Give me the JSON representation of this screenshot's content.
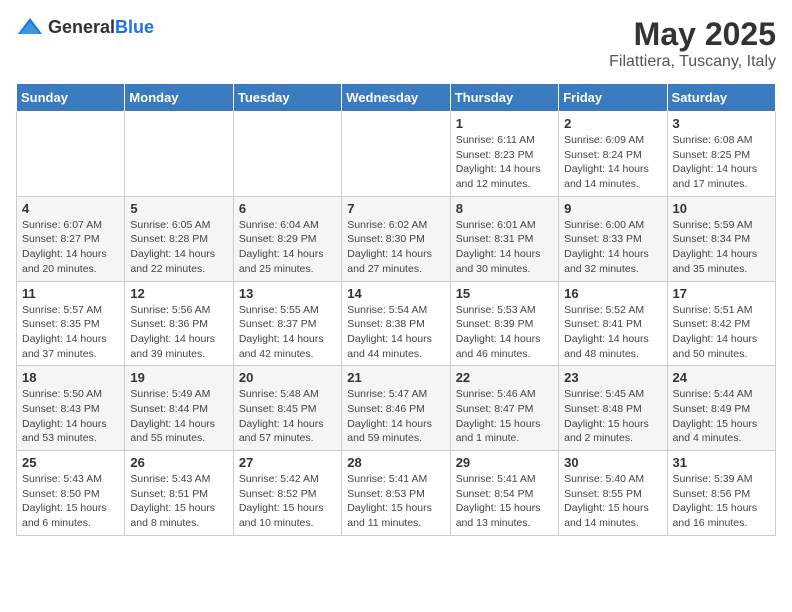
{
  "logo": {
    "general": "General",
    "blue": "Blue"
  },
  "title": "May 2025",
  "subtitle": "Filattiera, Tuscany, Italy",
  "days": [
    "Sunday",
    "Monday",
    "Tuesday",
    "Wednesday",
    "Thursday",
    "Friday",
    "Saturday"
  ],
  "weeks": [
    [
      {
        "day": "",
        "info": ""
      },
      {
        "day": "",
        "info": ""
      },
      {
        "day": "",
        "info": ""
      },
      {
        "day": "",
        "info": ""
      },
      {
        "day": "1",
        "info": "Sunrise: 6:11 AM\nSunset: 8:23 PM\nDaylight: 14 hours and 12 minutes."
      },
      {
        "day": "2",
        "info": "Sunrise: 6:09 AM\nSunset: 8:24 PM\nDaylight: 14 hours and 14 minutes."
      },
      {
        "day": "3",
        "info": "Sunrise: 6:08 AM\nSunset: 8:25 PM\nDaylight: 14 hours and 17 minutes."
      }
    ],
    [
      {
        "day": "4",
        "info": "Sunrise: 6:07 AM\nSunset: 8:27 PM\nDaylight: 14 hours and 20 minutes."
      },
      {
        "day": "5",
        "info": "Sunrise: 6:05 AM\nSunset: 8:28 PM\nDaylight: 14 hours and 22 minutes."
      },
      {
        "day": "6",
        "info": "Sunrise: 6:04 AM\nSunset: 8:29 PM\nDaylight: 14 hours and 25 minutes."
      },
      {
        "day": "7",
        "info": "Sunrise: 6:02 AM\nSunset: 8:30 PM\nDaylight: 14 hours and 27 minutes."
      },
      {
        "day": "8",
        "info": "Sunrise: 6:01 AM\nSunset: 8:31 PM\nDaylight: 14 hours and 30 minutes."
      },
      {
        "day": "9",
        "info": "Sunrise: 6:00 AM\nSunset: 8:33 PM\nDaylight: 14 hours and 32 minutes."
      },
      {
        "day": "10",
        "info": "Sunrise: 5:59 AM\nSunset: 8:34 PM\nDaylight: 14 hours and 35 minutes."
      }
    ],
    [
      {
        "day": "11",
        "info": "Sunrise: 5:57 AM\nSunset: 8:35 PM\nDaylight: 14 hours and 37 minutes."
      },
      {
        "day": "12",
        "info": "Sunrise: 5:56 AM\nSunset: 8:36 PM\nDaylight: 14 hours and 39 minutes."
      },
      {
        "day": "13",
        "info": "Sunrise: 5:55 AM\nSunset: 8:37 PM\nDaylight: 14 hours and 42 minutes."
      },
      {
        "day": "14",
        "info": "Sunrise: 5:54 AM\nSunset: 8:38 PM\nDaylight: 14 hours and 44 minutes."
      },
      {
        "day": "15",
        "info": "Sunrise: 5:53 AM\nSunset: 8:39 PM\nDaylight: 14 hours and 46 minutes."
      },
      {
        "day": "16",
        "info": "Sunrise: 5:52 AM\nSunset: 8:41 PM\nDaylight: 14 hours and 48 minutes."
      },
      {
        "day": "17",
        "info": "Sunrise: 5:51 AM\nSunset: 8:42 PM\nDaylight: 14 hours and 50 minutes."
      }
    ],
    [
      {
        "day": "18",
        "info": "Sunrise: 5:50 AM\nSunset: 8:43 PM\nDaylight: 14 hours and 53 minutes."
      },
      {
        "day": "19",
        "info": "Sunrise: 5:49 AM\nSunset: 8:44 PM\nDaylight: 14 hours and 55 minutes."
      },
      {
        "day": "20",
        "info": "Sunrise: 5:48 AM\nSunset: 8:45 PM\nDaylight: 14 hours and 57 minutes."
      },
      {
        "day": "21",
        "info": "Sunrise: 5:47 AM\nSunset: 8:46 PM\nDaylight: 14 hours and 59 minutes."
      },
      {
        "day": "22",
        "info": "Sunrise: 5:46 AM\nSunset: 8:47 PM\nDaylight: 15 hours and 1 minute."
      },
      {
        "day": "23",
        "info": "Sunrise: 5:45 AM\nSunset: 8:48 PM\nDaylight: 15 hours and 2 minutes."
      },
      {
        "day": "24",
        "info": "Sunrise: 5:44 AM\nSunset: 8:49 PM\nDaylight: 15 hours and 4 minutes."
      }
    ],
    [
      {
        "day": "25",
        "info": "Sunrise: 5:43 AM\nSunset: 8:50 PM\nDaylight: 15 hours and 6 minutes."
      },
      {
        "day": "26",
        "info": "Sunrise: 5:43 AM\nSunset: 8:51 PM\nDaylight: 15 hours and 8 minutes."
      },
      {
        "day": "27",
        "info": "Sunrise: 5:42 AM\nSunset: 8:52 PM\nDaylight: 15 hours and 10 minutes."
      },
      {
        "day": "28",
        "info": "Sunrise: 5:41 AM\nSunset: 8:53 PM\nDaylight: 15 hours and 11 minutes."
      },
      {
        "day": "29",
        "info": "Sunrise: 5:41 AM\nSunset: 8:54 PM\nDaylight: 15 hours and 13 minutes."
      },
      {
        "day": "30",
        "info": "Sunrise: 5:40 AM\nSunset: 8:55 PM\nDaylight: 15 hours and 14 minutes."
      },
      {
        "day": "31",
        "info": "Sunrise: 5:39 AM\nSunset: 8:56 PM\nDaylight: 15 hours and 16 minutes."
      }
    ]
  ]
}
